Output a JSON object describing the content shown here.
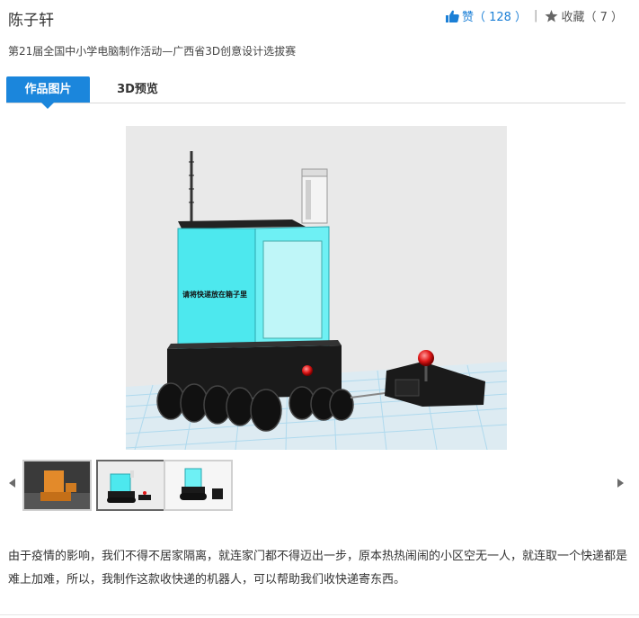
{
  "header": {
    "title": "陈子轩",
    "like_label": "赞",
    "like_count": "（ 128 ）",
    "separator": "|",
    "favorite_label": "收藏",
    "favorite_count": "（ 7 ）",
    "like_color": "#1b7fd6"
  },
  "subtitle": "第21届全国中小学电脑制作活动—广西省3D创意设计选拔赛",
  "tabs": [
    {
      "label": "作品图片",
      "active": true
    },
    {
      "label": "3D预览",
      "active": false
    }
  ],
  "main_image": {
    "box_label": "请将快递放在箱子里",
    "colors": {
      "box": "#4de8ee",
      "base": "#1a1a1a",
      "grid": "#a9d8ee"
    }
  },
  "gallery": {
    "selected_index": 1,
    "thumbnails": [
      {
        "icon": "orange-render-thumbnail"
      },
      {
        "icon": "robot-front-thumbnail"
      },
      {
        "icon": "robot-side-thumbnail"
      }
    ]
  },
  "description": "由于疫情的影响，我们不得不居家隔离，就连家门都不得迈出一步，原本热热闹闹的小区空无一人，就连取一个快递都是难上加难，所以，我制作这款收快递的机器人，可以帮助我们收快递寄东西。"
}
